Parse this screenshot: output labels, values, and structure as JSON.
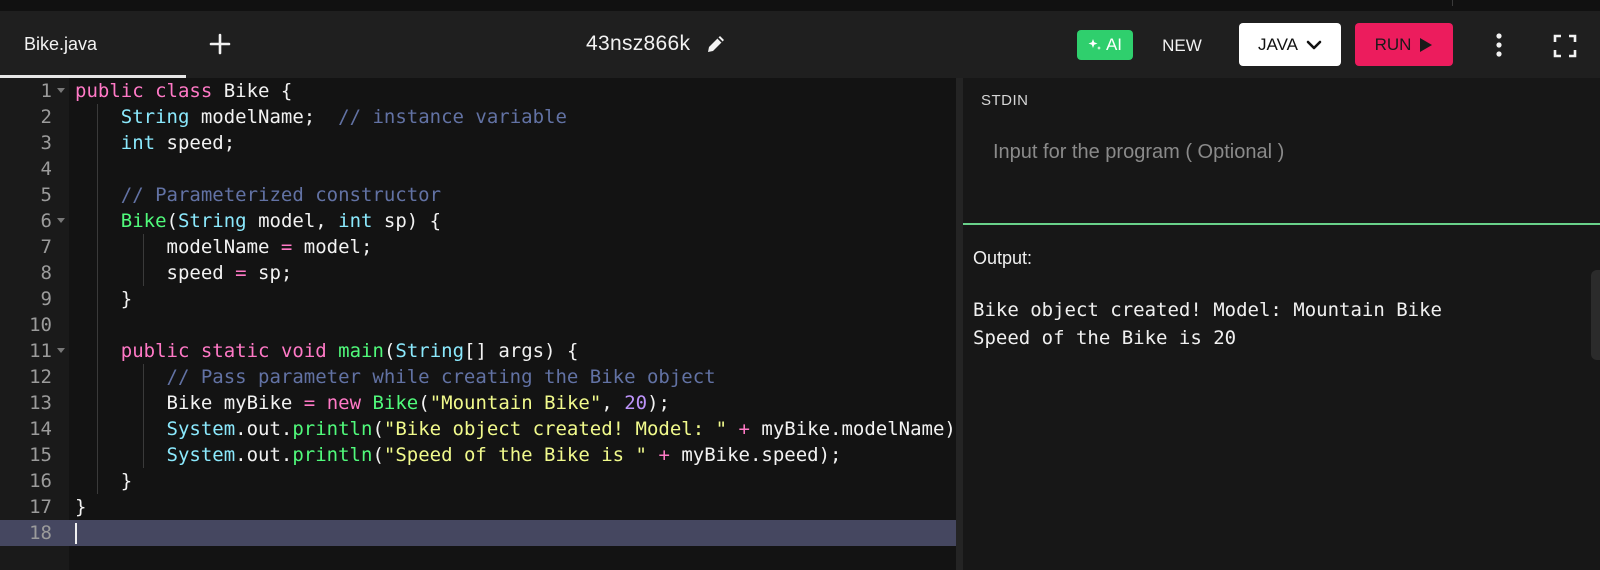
{
  "tab": {
    "label": "Bike.java",
    "add_icon": "plus-icon"
  },
  "header": {
    "title": "43nsz866k",
    "edit_icon": "pencil-icon"
  },
  "toolbar": {
    "ai_label": "AI",
    "new_label": "NEW",
    "language": "JAVA",
    "run_label": "RUN",
    "more_icon": "vertical-dots-icon",
    "fullscreen_icon": "fullscreen-icon"
  },
  "colors": {
    "ai_button": "#2fcf6d",
    "run_button": "#ec1c5d",
    "active_line": "#454760",
    "separator": "#69d18a"
  },
  "editor": {
    "active_line": 18,
    "lines": [
      {
        "num": "1"
      },
      {
        "num": "2"
      },
      {
        "num": "3"
      },
      {
        "num": "4"
      },
      {
        "num": "5"
      },
      {
        "num": "6"
      },
      {
        "num": "7"
      },
      {
        "num": "8"
      },
      {
        "num": "9"
      },
      {
        "num": "10"
      },
      {
        "num": "11"
      },
      {
        "num": "12"
      },
      {
        "num": "13"
      },
      {
        "num": "14"
      },
      {
        "num": "15"
      },
      {
        "num": "16"
      },
      {
        "num": "17"
      },
      {
        "num": "18"
      }
    ],
    "tokens": {
      "l1": [
        "public",
        "class",
        " Bike {"
      ],
      "l2": [
        "String",
        " modelName;  ",
        "// instance variable"
      ],
      "l3": [
        "int",
        " speed;"
      ],
      "l5": [
        "// Parameterized constructor"
      ],
      "l6": [
        "Bike",
        "(",
        "String",
        " model, ",
        "int",
        " sp) {"
      ],
      "l7": [
        "modelName ",
        "=",
        " model;"
      ],
      "l8": [
        "speed ",
        "=",
        " sp;"
      ],
      "l9": [
        "}"
      ],
      "l11": [
        "public",
        "static",
        "void",
        "main",
        "(",
        "String",
        "[] args) {"
      ],
      "l12": [
        "// Pass parameter while creating the Bike object"
      ],
      "l13": [
        "Bike myBike ",
        "=",
        "new",
        "Bike",
        "(",
        "\"Mountain Bike\"",
        ", ",
        "20",
        ");"
      ],
      "l14": [
        "System",
        ".out.",
        "println",
        "(",
        "\"Bike object created! Model: \"",
        " + ",
        "myBike.modelName);"
      ],
      "l15": [
        "System",
        ".out.",
        "println",
        "(",
        "\"Speed of the Bike is \"",
        " + ",
        "myBike.speed);"
      ],
      "l16": [
        "}"
      ],
      "l17": [
        "}"
      ]
    }
  },
  "stdin": {
    "label": "STDIN",
    "placeholder": "Input for the program ( Optional )"
  },
  "output": {
    "label": "Output:",
    "lines": [
      "Bike object created! Model: Mountain Bike",
      "Speed of the Bike is 20"
    ]
  }
}
